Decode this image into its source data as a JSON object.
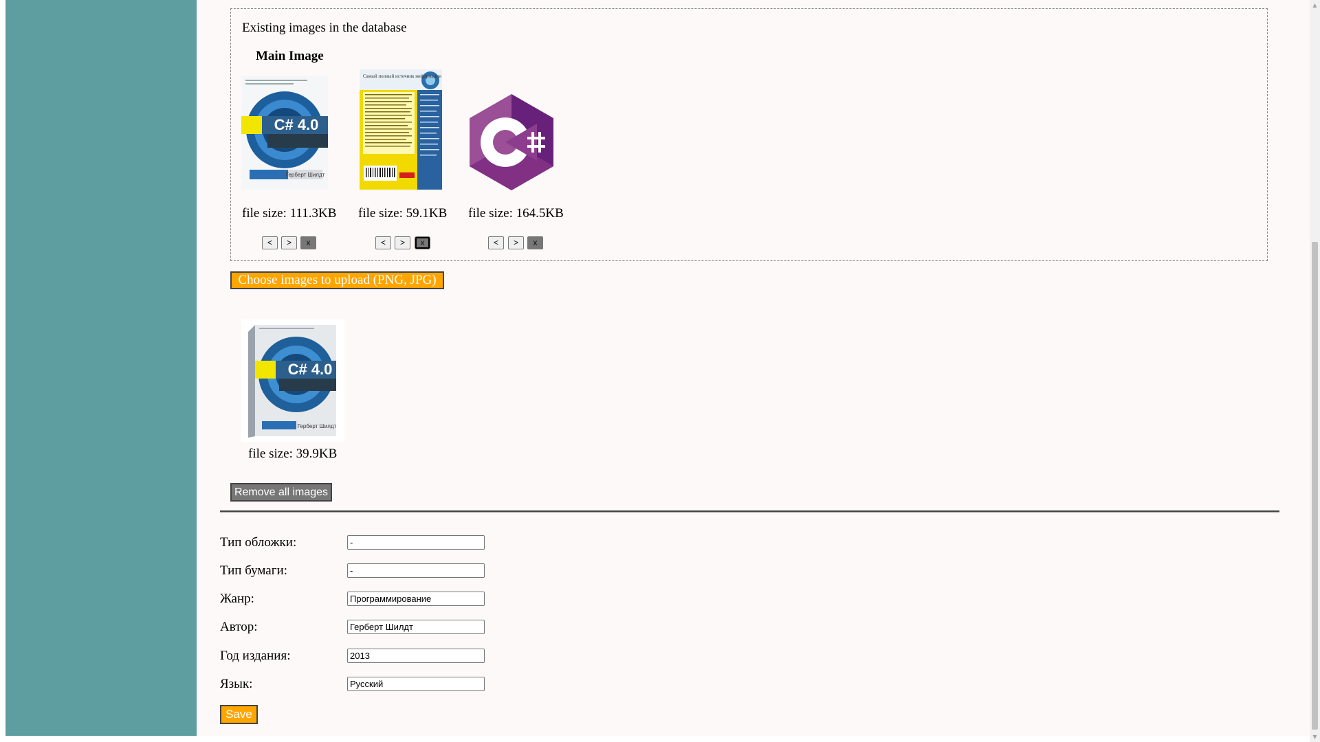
{
  "existing_images": {
    "title": "Existing images in the database",
    "main_image_label": "Main Image",
    "items": [
      {
        "file_size": "file size: 111.3KB",
        "icon": "csharp-4-book-cover-front",
        "cover_text": "C# 4.0",
        "author_text": "Герберт Шилдт"
      },
      {
        "file_size": "file size: 59.1KB",
        "icon": "csharp-book-cover-back",
        "cover_text": "Самый полный источник информации по C#"
      },
      {
        "file_size": "file size: 164.5KB",
        "icon": "csharp-logo"
      }
    ],
    "controls": {
      "prev": "<",
      "next": ">",
      "remove": "x"
    }
  },
  "upload": {
    "button_label": "Choose images to upload (PNG, JPG)",
    "preview": {
      "file_size": "file size: 39.9KB",
      "icon": "csharp-4-book-3d",
      "cover_text": "C# 4.0",
      "author_text": "Герберт Шилдт"
    }
  },
  "remove_all_label": "Remove all images",
  "form": {
    "fields": [
      {
        "label": "Тип обложки:",
        "value": "-"
      },
      {
        "label": "Тип бумаги:",
        "value": "-"
      },
      {
        "label": "Жанр:",
        "value": "Программирование"
      },
      {
        "label": "Автор:",
        "value": "Герберт Шилдт"
      },
      {
        "label": "Год издания:",
        "value": "2013"
      },
      {
        "label": "Язык:",
        "value": "Русский"
      }
    ],
    "save_label": "Save"
  },
  "colors": {
    "sidebar": "#5f9ea0",
    "accent": "#ffa500",
    "button_gray": "#777777",
    "page_bg": "#fdf9f8"
  }
}
